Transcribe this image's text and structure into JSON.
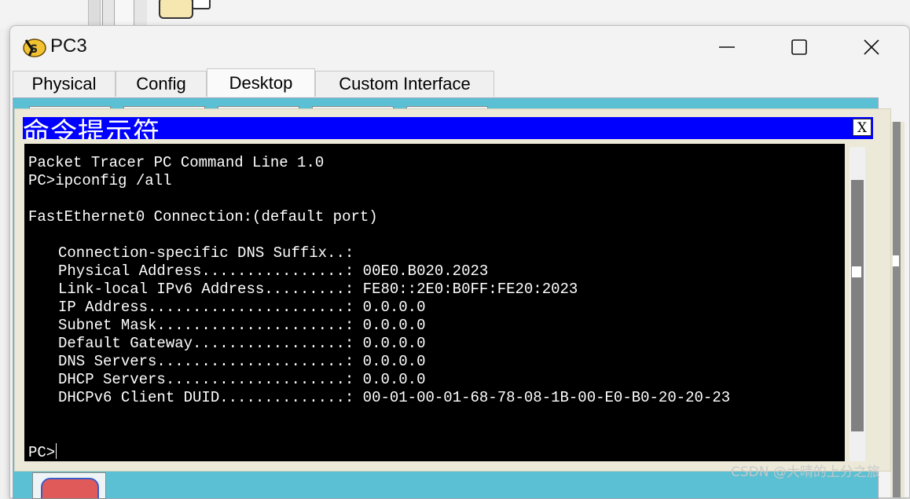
{
  "window": {
    "title": "PC3",
    "colors": {
      "content_bg": "#5bc0d3",
      "cmd_title_bg": "#0000ff",
      "terminal_bg": "#000000",
      "terminal_fg": "#ffffff"
    }
  },
  "tabs": [
    {
      "label": "Physical",
      "active": false
    },
    {
      "label": "Config",
      "active": false
    },
    {
      "label": "Desktop",
      "active": true
    },
    {
      "label": "Custom Interface",
      "active": false
    }
  ],
  "command_prompt": {
    "title": "命令提示符",
    "close_label": "X",
    "lines": [
      "Packet Tracer PC Command Line 1.0",
      "PC>ipconfig /all",
      "",
      "FastEthernet0 Connection:(default port)",
      "",
      "Connection-specific DNS Suffix..: ",
      "Physical Address................: 00E0.B020.2023",
      "Link-local IPv6 Address.........: FE80::2E0:B0FF:FE20:2023",
      "IP Address......................: 0.0.0.0",
      "Subnet Mask.....................: 0.0.0.0",
      "Default Gateway.................: 0.0.0.0",
      "DNS Servers.....................: 0.0.0.0",
      "DHCP Servers....................: 0.0.0.0",
      "DHCPv6 Client DUID..............: 00-01-00-01-68-78-08-1B-00-E0-B0-20-20-23",
      "",
      "",
      "PC>"
    ]
  },
  "icons": {
    "app": "packet-tracer-pc-icon",
    "minimize": "minimize-icon",
    "maximize": "maximize-icon",
    "close": "close-icon"
  },
  "watermark": "CSDN @大晴的上分之旅"
}
